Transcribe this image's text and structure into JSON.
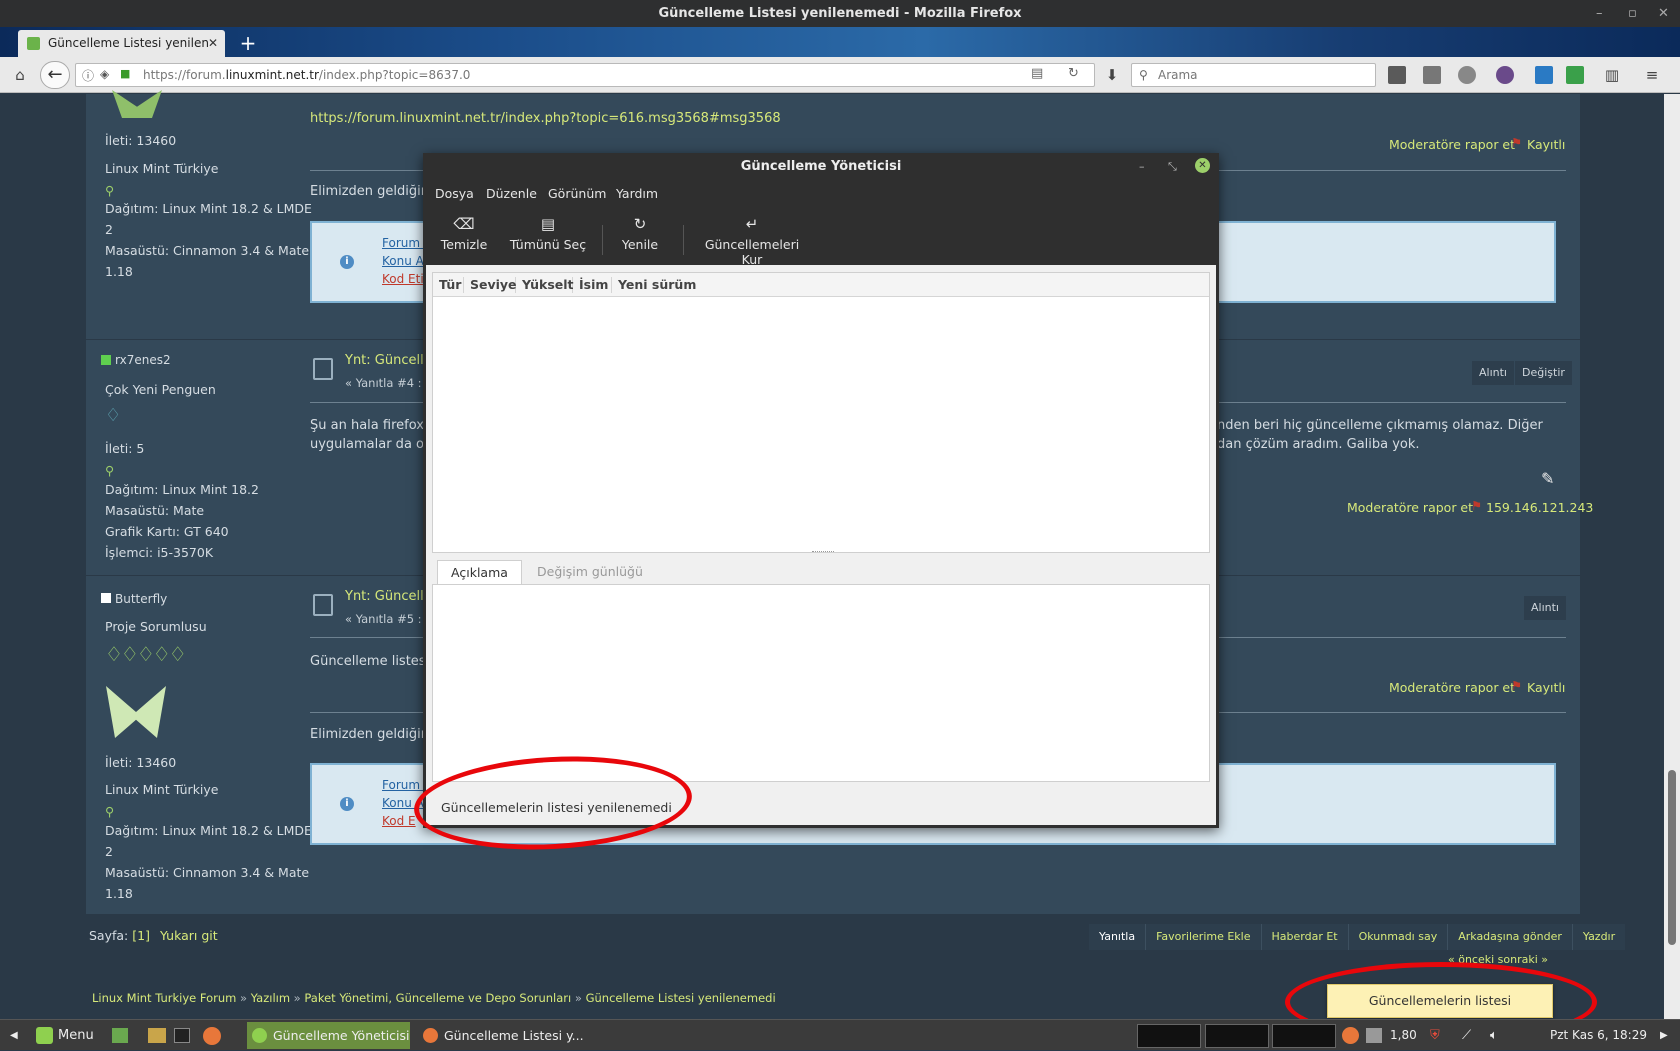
{
  "window": {
    "title": "Güncelleme Listesi yenilenemedi - Mozilla Firefox"
  },
  "browser": {
    "tab_title": "Güncelleme Listesi yenilen",
    "url_prefix": "https://forum.",
    "url_domain": "linuxmint.net.tr",
    "url_path": "/index.php?topic=8637.0",
    "search_placeholder": "Arama"
  },
  "forum": {
    "quoted_link": "https://forum.linuxmint.net.tr/index.php?topic=616.msg3568#msg3568",
    "report_label": "Moderatöre rapor et",
    "logged_label": "Kayıtlı",
    "ip_label": "159.146.121.243",
    "signature_start": "Elimizden geldiğince",
    "info_links": [
      "Forum K",
      "Konu A",
      "Kod Etik"
    ],
    "info_links2": [
      "Forum K",
      "Konu A",
      "Kod E"
    ],
    "posts": [
      {
        "posts_count": "İleti: 13460",
        "role": "Linux Mint Türkiye",
        "dist": "Dağıtım: Linux Mint 18.2 & LMDE",
        "dist2": "2",
        "desktop": "Masaüstü: Cinnamon 3.4 & Mate",
        "desktop2": "1.18"
      },
      {
        "user": "rx7enes2",
        "rank": "Çok Yeni Penguen",
        "posts_count": "İleti: 5",
        "dist": "Dağıtım: Linux Mint 18.2",
        "desktop": "Masaüstü: Mate",
        "gpu": "Grafik Kartı: GT 640",
        "cpu": "İşlemci: i5-3570K",
        "title": "Ynt: Güncelle",
        "meta": "« Yanıtla #4 : 0",
        "body1": "Şu an hala firefox 5",
        "body1_right": "nden beri hiç güncelleme çıkmamış olamaz. Diğer",
        "body2": "uygulamalar da ona",
        "body2_right": "dan çözüm aradım. Galiba yok.",
        "quote_btn": "Alıntı",
        "edit_btn": "Değiştir"
      },
      {
        "user": "Butterfly",
        "rank": "Proje Sorumlusu",
        "title": "Ynt: Güncelle",
        "meta": "« Yanıtla #5 : E",
        "body1": "Güncelleme listesi y",
        "quote_btn": "Alıntı",
        "posts_count": "İleti: 13460",
        "role": "Linux Mint Türkiye",
        "dist": "Dağıtım: Linux Mint 18.2 & LMDE",
        "dist2": "2",
        "desktop": "Masaüstü: Cinnamon 3.4 & Mate",
        "desktop2": "1.18"
      }
    ],
    "pages_label": "Sayfa:",
    "pages_value": "[1]",
    "go_up": "Yukarı git",
    "actions": [
      "Yanıtla",
      "Favorilerime Ekle",
      "Haberdar Et",
      "Okunmadı say",
      "Arkadaşına gönder",
      "Yazdır"
    ],
    "prev_next": "« önceki sonraki »",
    "breadcrumb": [
      "Linux Mint Turkiye Forum",
      "Yazılım",
      "Paket Yönetimi, Güncelleme ve Depo Sorunları",
      "Güncelleme Listesi yenilenemedi"
    ]
  },
  "dialog": {
    "title": "Güncelleme Yöneticisi",
    "menu": [
      "Dosya",
      "Düzenle",
      "Görünüm",
      "Yardım"
    ],
    "toolbar": [
      {
        "label": "Temizle",
        "icon": "backspace-icon"
      },
      {
        "label": "Tümünü Seç",
        "icon": "document-icon"
      },
      {
        "label": "Yenile",
        "icon": "refresh-icon"
      },
      {
        "label": "Güncellemeleri Kur",
        "icon": "enter-icon"
      }
    ],
    "columns": [
      "Tür",
      "Seviye",
      "Yükselt",
      "İsim",
      "Yeni sürüm"
    ],
    "tabs": [
      "Açıklama",
      "Değişim günlüğü"
    ],
    "status": "Güncellemelerin listesi yenilenemedi"
  },
  "notification": "Güncellemelerin listesi yenilenemedi",
  "taskbar": {
    "menu": "Menu",
    "apps": [
      "Güncelleme Yöneticisi",
      "Güncelleme Listesi y..."
    ],
    "load": "1,80",
    "clock": "Pzt Kas  6, 18:29"
  },
  "colors": {
    "forum_bg": "#34495a",
    "accent_link": "#d7e97a",
    "annotation": "#e8070b"
  }
}
